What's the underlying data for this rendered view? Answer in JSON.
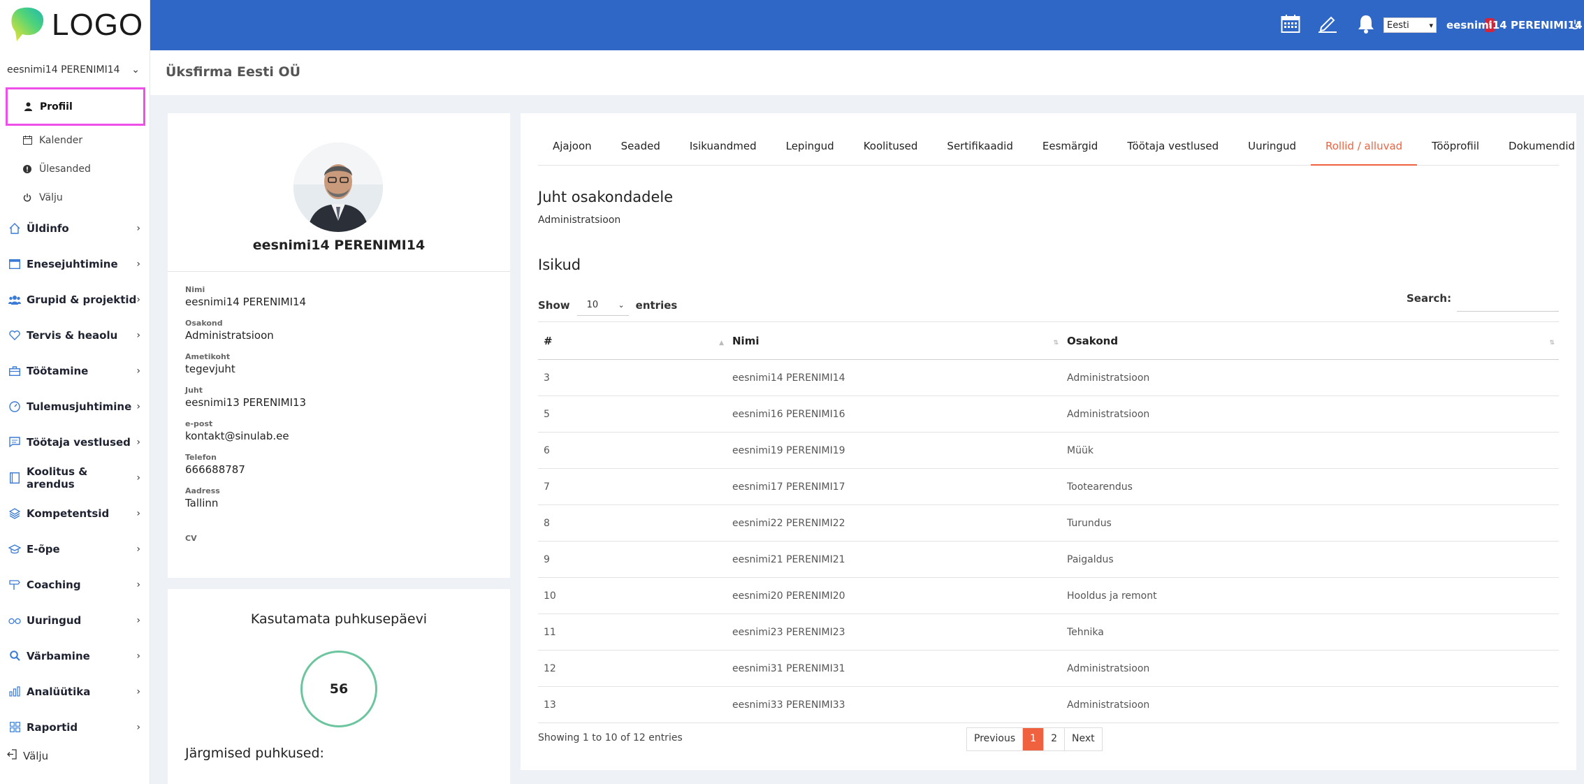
{
  "sidebar": {
    "logo_text": "LOGO",
    "user_name": "eesnimi14 PERENIMI14",
    "sub_items": [
      {
        "label": "Profiil",
        "icon": "user-icon"
      },
      {
        "label": "Kalender",
        "icon": "calendar-icon"
      },
      {
        "label": "Ülesanded",
        "icon": "info-icon"
      },
      {
        "label": "Välju",
        "icon": "power-icon"
      }
    ],
    "menu": [
      {
        "label": "Üldinfo",
        "icon": "home-icon"
      },
      {
        "label": "Enesejuhtimine",
        "icon": "window-icon"
      },
      {
        "label": "Grupid & projektid",
        "icon": "users-icon"
      },
      {
        "label": "Tervis & heaolu",
        "icon": "heart-icon"
      },
      {
        "label": "Töötamine",
        "icon": "briefcase-icon"
      },
      {
        "label": "Tulemusjuhtimine",
        "icon": "gauge-icon"
      },
      {
        "label": "Töötaja vestlused",
        "icon": "chat-icon"
      },
      {
        "label": "Koolitus & arendus",
        "icon": "book-icon"
      },
      {
        "label": "Kompetentsid",
        "icon": "layers-icon"
      },
      {
        "label": "E-õpe",
        "icon": "graduation-cap-icon"
      },
      {
        "label": "Coaching",
        "icon": "signpost-icon"
      },
      {
        "label": "Uuringud",
        "icon": "glasses-icon"
      },
      {
        "label": "Värbamine",
        "icon": "search-icon"
      },
      {
        "label": "Analüütika",
        "icon": "bar-chart-icon"
      },
      {
        "label": "Raportid",
        "icon": "grid-icon"
      }
    ],
    "logout_label": "Välju"
  },
  "topbar": {
    "badge": "!",
    "language": "Eesti",
    "user_name": "eesnimi14 PERENIMI14",
    "bg_color": "#2f67c7"
  },
  "page": {
    "company": "Üksfirma Eesti OÜ"
  },
  "profile": {
    "name": "eesnimi14 PERENIMI14",
    "fields": [
      {
        "label": "Nimi",
        "value": "eesnimi14 PERENIMI14"
      },
      {
        "label": "Osakond",
        "value": "Administratsioon"
      },
      {
        "label": "Ametikoht",
        "value": "tegevjuht"
      },
      {
        "label": "Juht",
        "value": "eesnimi13 PERENIMI13"
      },
      {
        "label": "e-post",
        "value": "kontakt@sinulab.ee"
      },
      {
        "label": "Telefon",
        "value": "666688787"
      },
      {
        "label": "Aadress",
        "value": "Tallinn"
      },
      {
        "label": "CV",
        "value": ""
      }
    ]
  },
  "vacation": {
    "title": "Kasutamata puhkusepäevi",
    "days": "56",
    "next_label": "Järgmised puhkused:"
  },
  "tabs": [
    {
      "label": "Ajajoon",
      "active": false
    },
    {
      "label": "Seaded",
      "active": false
    },
    {
      "label": "Isikuandmed",
      "active": false
    },
    {
      "label": "Lepingud",
      "active": false
    },
    {
      "label": "Koolitused",
      "active": false
    },
    {
      "label": "Sertifikaadid",
      "active": false
    },
    {
      "label": "Eesmärgid",
      "active": false
    },
    {
      "label": "Töötaja vestlused",
      "active": false
    },
    {
      "label": "Uuringud",
      "active": false
    },
    {
      "label": "Rollid / alluvad",
      "active": true
    },
    {
      "label": "Tööprofiil",
      "active": false
    },
    {
      "label": "Dokumendid",
      "active": false
    }
  ],
  "roles": {
    "juht_heading": "Juht osakondadele",
    "juht_value": "Administratsioon",
    "isikud_heading": "Isikud",
    "show_label": "Show",
    "show_value": "10",
    "entries_label": "entries",
    "search_label": "Search:",
    "search_value": "",
    "columns": [
      "#",
      "Nimi",
      "Osakond"
    ],
    "rows": [
      [
        "3",
        "eesnimi14 PERENIMI14",
        "Administratsioon"
      ],
      [
        "5",
        "eesnimi16 PERENIMI16",
        "Administratsioon"
      ],
      [
        "6",
        "eesnimi19 PERENIMI19",
        "Müük"
      ],
      [
        "7",
        "eesnimi17 PERENIMI17",
        "Tootearendus"
      ],
      [
        "8",
        "eesnimi22 PERENIMI22",
        "Turundus"
      ],
      [
        "9",
        "eesnimi21 PERENIMI21",
        "Paigaldus"
      ],
      [
        "10",
        "eesnimi20 PERENIMI20",
        "Hooldus ja remont"
      ],
      [
        "11",
        "eesnimi23 PERENIMI23",
        "Tehnika"
      ],
      [
        "12",
        "eesnimi31 PERENIMI31",
        "Administratsioon"
      ],
      [
        "13",
        "eesnimi33 PERENIMI33",
        "Administratsioon"
      ]
    ],
    "info": "Showing 1 to 10 of 12 entries",
    "pager": {
      "previous": "Previous",
      "pages": [
        "1",
        "2"
      ],
      "current": "1",
      "next": "Next"
    }
  },
  "colors": {
    "accent": "#f0623f",
    "brand_blue": "#2f67c7",
    "highlight": "#ee4fe9",
    "ring": "#6cc59f"
  }
}
